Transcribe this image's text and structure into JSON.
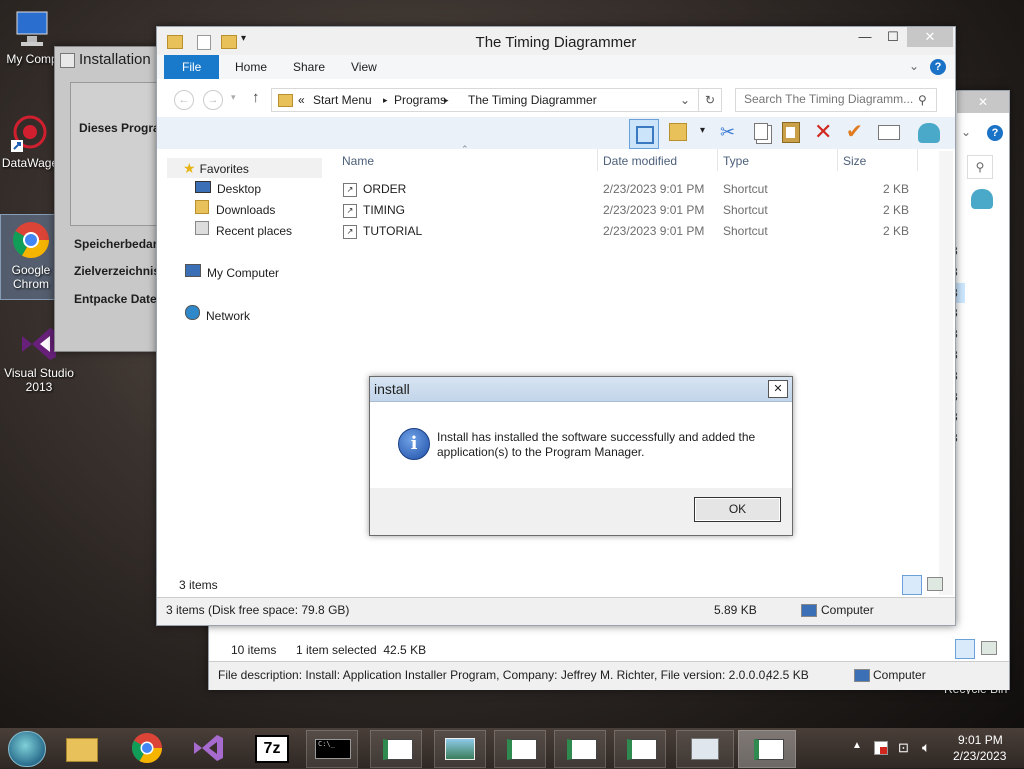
{
  "desktop": {
    "icons": [
      {
        "label": "My Comp"
      },
      {
        "label": "DataWage"
      },
      {
        "label": "Google Chrom"
      },
      {
        "label": "Visual Studio 2013"
      }
    ],
    "recycle_label": "Recycle Bin"
  },
  "installer": {
    "title": "Installation",
    "heading": "Dieses Progra",
    "labels": [
      "Speicherbedar",
      "Zielverzeichnis",
      "Entpacke Date"
    ]
  },
  "back_explorer": {
    "row_suffix": [
      "3",
      "3",
      "3",
      "3",
      "3",
      "3",
      "3",
      "3",
      "3",
      "3"
    ],
    "status_items": "10 items",
    "status_selected": "1 item selected  42.5 KB",
    "details": "File description: Install: Application Installer Program, Company: Jeffrey M. Richter, File version: 2.0.0.0,",
    "details_size": "42.5 KB",
    "details_location": "Computer"
  },
  "explorer": {
    "title": "The Timing Diagrammer",
    "tabs": {
      "file": "File",
      "home": "Home",
      "share": "Share",
      "view": "View"
    },
    "breadcrumb": {
      "prefix": "«",
      "parts": [
        "Start Menu",
        "Programs",
        "The Timing Diagrammer"
      ]
    },
    "search_placeholder": "Search The Timing Diagramm...",
    "nav": {
      "favorites": "Favorites",
      "desktop": "Desktop",
      "downloads": "Downloads",
      "recent": "Recent places",
      "computer": "My Computer",
      "network": "Network"
    },
    "columns": {
      "name": "Name",
      "date": "Date modified",
      "type": "Type",
      "size": "Size"
    },
    "files": [
      {
        "name": "ORDER",
        "date": "2/23/2023 9:01 PM",
        "type": "Shortcut",
        "size": "2 KB"
      },
      {
        "name": "TIMING",
        "date": "2/23/2023 9:01 PM",
        "type": "Shortcut",
        "size": "2 KB"
      },
      {
        "name": "TUTORIAL",
        "date": "2/23/2023 9:01 PM",
        "type": "Shortcut",
        "size": "2 KB"
      }
    ],
    "item_count": "3 items",
    "status_left": "3 items (Disk free space: 79.8 GB)",
    "status_size": "5.89 KB",
    "status_location": "Computer"
  },
  "dialog": {
    "title": "install",
    "message_line1": "Install has installed the software successfully and added the",
    "message_line2": "application(s) to the Program Manager.",
    "ok_label": "OK",
    "close_glyph": "✕"
  },
  "taskbar": {
    "time": "9:01 PM",
    "date": "2/23/2023"
  }
}
